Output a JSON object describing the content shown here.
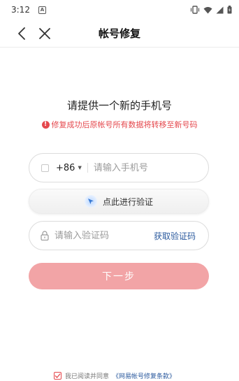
{
  "status_bar": {
    "time": "3:12",
    "notification_glyph": "A"
  },
  "nav": {
    "title": "帐号修复"
  },
  "content": {
    "headline": "请提供一个新的手机号",
    "warning_icon": "!",
    "warning": "修复成功后原帐号所有数据将转移至新号码"
  },
  "phone": {
    "country_code": "+86",
    "caret": "▼",
    "value": "",
    "placeholder": "请输入手机号"
  },
  "verify": {
    "label": "点此进行验证"
  },
  "code": {
    "value": "",
    "placeholder": "请输入验证码",
    "get_code_label": "获取验证码"
  },
  "next_button": {
    "label": "下一步"
  },
  "agreement": {
    "text": "我已阅读并同意",
    "link": "《网易帐号修复条款》"
  },
  "colors": {
    "warning": "#e5484d",
    "link": "#2b5a9e",
    "next_button_bg": "#f2a4a6"
  }
}
